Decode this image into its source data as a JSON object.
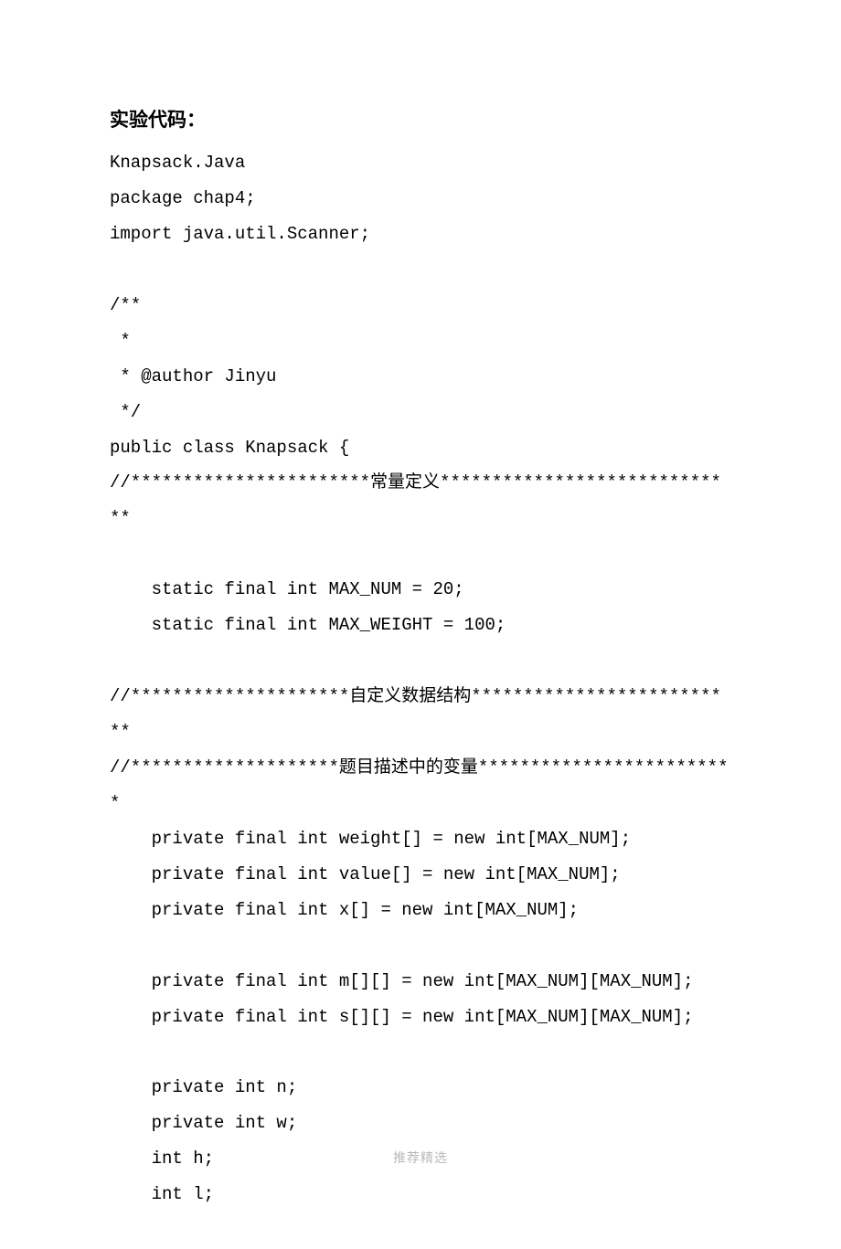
{
  "heading": "实验代码：",
  "code": "Knapsack.Java\npackage chap4;\nimport java.util.Scanner;\n\n/**\n *\n * @author Jinyu\n */\npublic class Knapsack {\n//***********************常量定义*****************************\n\n    static final int MAX_NUM = 20;\n    static final int MAX_WEIGHT = 100;\n\n//*********************自定义数据结构**************************\n//********************题目描述中的变量*************************\n    private final int weight[] = new int[MAX_NUM];\n    private final int value[] = new int[MAX_NUM];\n    private final int x[] = new int[MAX_NUM];\n\n    private final int m[][] = new int[MAX_NUM][MAX_NUM];\n    private final int s[][] = new int[MAX_NUM][MAX_NUM];\n\n    private int n;\n    private int w;\n    int h;\n    int l;",
  "footer": "推荐精选"
}
